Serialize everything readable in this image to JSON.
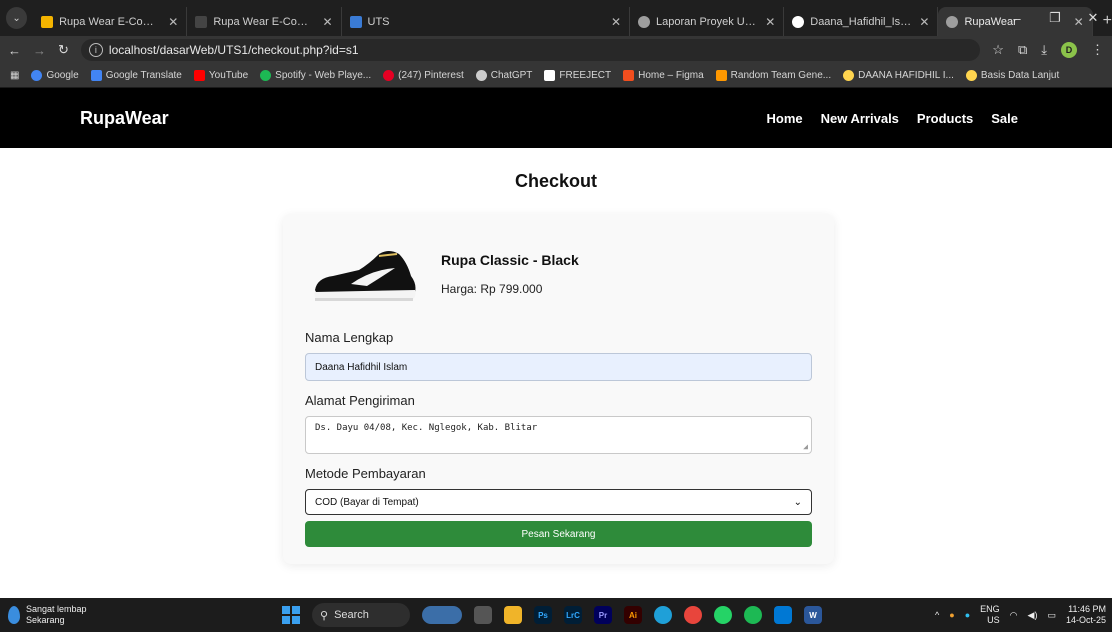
{
  "browser": {
    "tabs": [
      {
        "title": "Rupa Wear E-Commerce -",
        "color": "#f4b400"
      },
      {
        "title": "Rupa Wear E-Commerce",
        "color": "#444"
      },
      {
        "title": "UTS",
        "color": "#3a7bd5"
      },
      {
        "title": "Laporan Proyek UTS.docx",
        "color": "#9e9e9e"
      },
      {
        "title": "Daana_Hafidhil_Islam_DESI",
        "color": "#ffffff"
      },
      {
        "title": "RupaWear",
        "color": "#9e9e9e"
      }
    ],
    "url": "localhost/dasarWeb/UTS1/checkout.php?id=s1",
    "profile_initial": "D",
    "bookmarks": [
      {
        "label": "Google",
        "color": "#4285f4"
      },
      {
        "label": "Google Translate",
        "color": "#4285f4"
      },
      {
        "label": "YouTube",
        "color": "#ff0000"
      },
      {
        "label": "Spotify - Web Playe...",
        "color": "#1db954"
      },
      {
        "label": "(247) Pinterest",
        "color": "#e60023"
      },
      {
        "label": "ChatGPT",
        "color": "#cccccc"
      },
      {
        "label": "FREEJECT",
        "color": "#ffffff"
      },
      {
        "label": "Home – Figma",
        "color": "#f24e1e"
      },
      {
        "label": "Random Team Gene...",
        "color": "#ff9800"
      },
      {
        "label": "DAANA HAFIDHIL I...",
        "color": "#ffd54f"
      },
      {
        "label": "Basis Data Lanjut",
        "color": "#ffd54f"
      }
    ]
  },
  "site": {
    "brand": "RupaWear",
    "nav": [
      "Home",
      "New Arrivals",
      "Products",
      "Sale"
    ]
  },
  "checkout": {
    "heading": "Checkout",
    "product_name": "Rupa Classic - Black",
    "product_price": "Harga: Rp 799.000",
    "name_label": "Nama Lengkap",
    "name_value": "Daana Hafidhil Islam",
    "address_label": "Alamat Pengiriman",
    "address_value": "Ds. Dayu 04/08, Kec. Nglegok, Kab. Blitar",
    "payment_label": "Metode Pembayaran",
    "payment_value": "COD (Bayar di Tempat)",
    "submit_label": "Pesan Sekarang"
  },
  "taskbar": {
    "weather_title": "Sangat lembap",
    "weather_sub": "Sekarang",
    "search": "Search",
    "lang": "ENG",
    "region": "US",
    "time": "11:46 PM",
    "date": "14-Oct-25"
  }
}
